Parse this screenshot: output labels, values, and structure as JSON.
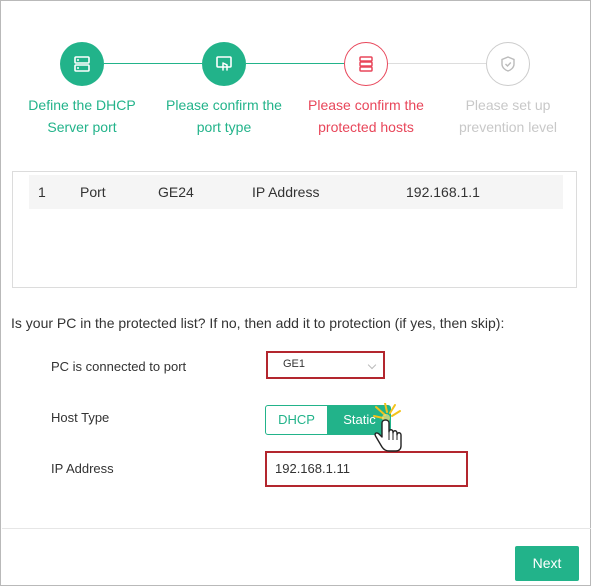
{
  "colors": {
    "green": "#22b38a",
    "red": "#e8465a",
    "gray": "#cccccc",
    "highlight": "#b3262e"
  },
  "steps": [
    {
      "line1": "Define the DHCP",
      "line2": "Server port",
      "state": "done",
      "icon": "server-icon"
    },
    {
      "line1": "Please confirm the",
      "line2": "port type",
      "state": "done",
      "icon": "touch-screen-icon"
    },
    {
      "line1": "Please confirm the",
      "line2": "protected hosts",
      "state": "active",
      "icon": "host-list-icon"
    },
    {
      "line1": "Please set up",
      "line2": "prevention level",
      "state": "pending",
      "icon": "shield-check-icon"
    }
  ],
  "table": {
    "rows": [
      {
        "index": "1",
        "type": "Port",
        "port": "GE24",
        "addr_label": "IP Address",
        "ip": "192.168.1.1"
      }
    ]
  },
  "question": "Is your PC in the protected list? If no, then add it to protection (if yes, then skip):",
  "form": {
    "port_label": "PC is connected to port",
    "port_value": "GE1",
    "host_type_label": "Host Type",
    "host_type_options": [
      "DHCP",
      "Static"
    ],
    "host_type_selected": "Static",
    "ip_label": "IP Address",
    "ip_value": "192.168.1.11"
  },
  "footer": {
    "next_label": "Next"
  }
}
